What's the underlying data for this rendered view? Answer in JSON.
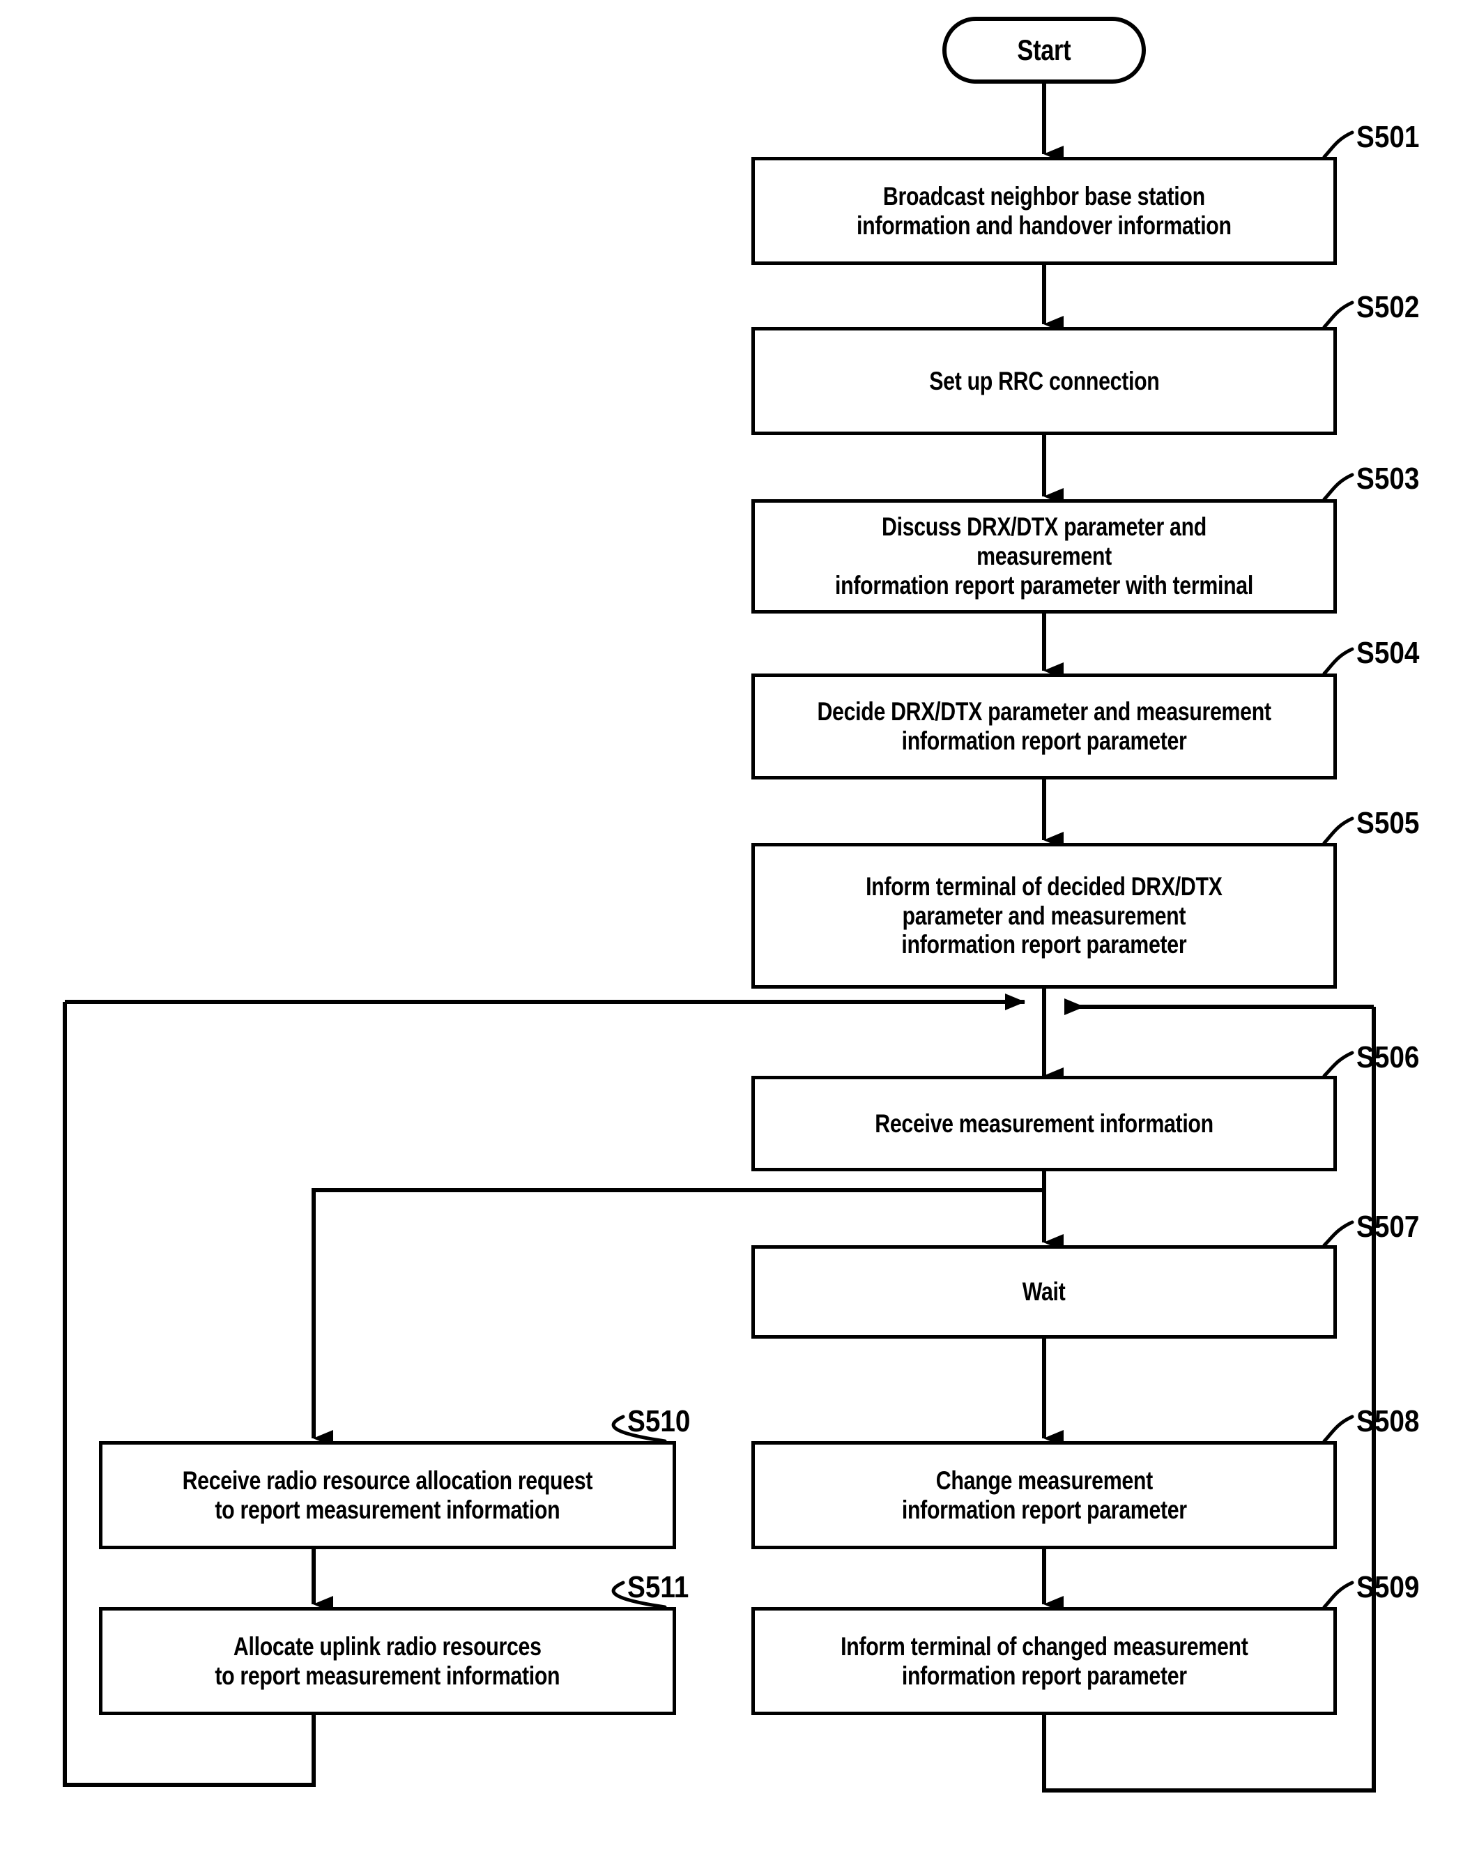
{
  "diagram": {
    "title": "Base station handover / measurement report procedure flowchart",
    "start_label": "Start",
    "line_color": "#000000",
    "background_color": "#ffffff"
  },
  "steps": [
    {
      "id": "S501",
      "label": "S501",
      "text": "Broadcast neighbor base station\ninformation and handover information"
    },
    {
      "id": "S502",
      "label": "S502",
      "text": "Set up RRC connection"
    },
    {
      "id": "S503",
      "label": "S503",
      "text": "Discuss DRX/DTX parameter and measurement\ninformation report parameter with terminal"
    },
    {
      "id": "S504",
      "label": "S504",
      "text": "Decide DRX/DTX parameter and measurement\ninformation report parameter"
    },
    {
      "id": "S505",
      "label": "S505",
      "text": "Inform terminal of decided DRX/DTX\nparameter and measurement\ninformation report parameter"
    },
    {
      "id": "S506",
      "label": "S506",
      "text": "Receive measurement information"
    },
    {
      "id": "S507",
      "label": "S507",
      "text": "Wait"
    },
    {
      "id": "S508",
      "label": "S508",
      "text": "Change measurement\ninformation report parameter"
    },
    {
      "id": "S509",
      "label": "S509",
      "text": "Inform terminal of changed measurement\ninformation report parameter"
    },
    {
      "id": "S510",
      "label": "S510",
      "text": "Receive radio resource allocation request\nto report measurement information"
    },
    {
      "id": "S511",
      "label": "S511",
      "text": "Allocate uplink radio resources\nto report measurement information"
    }
  ]
}
